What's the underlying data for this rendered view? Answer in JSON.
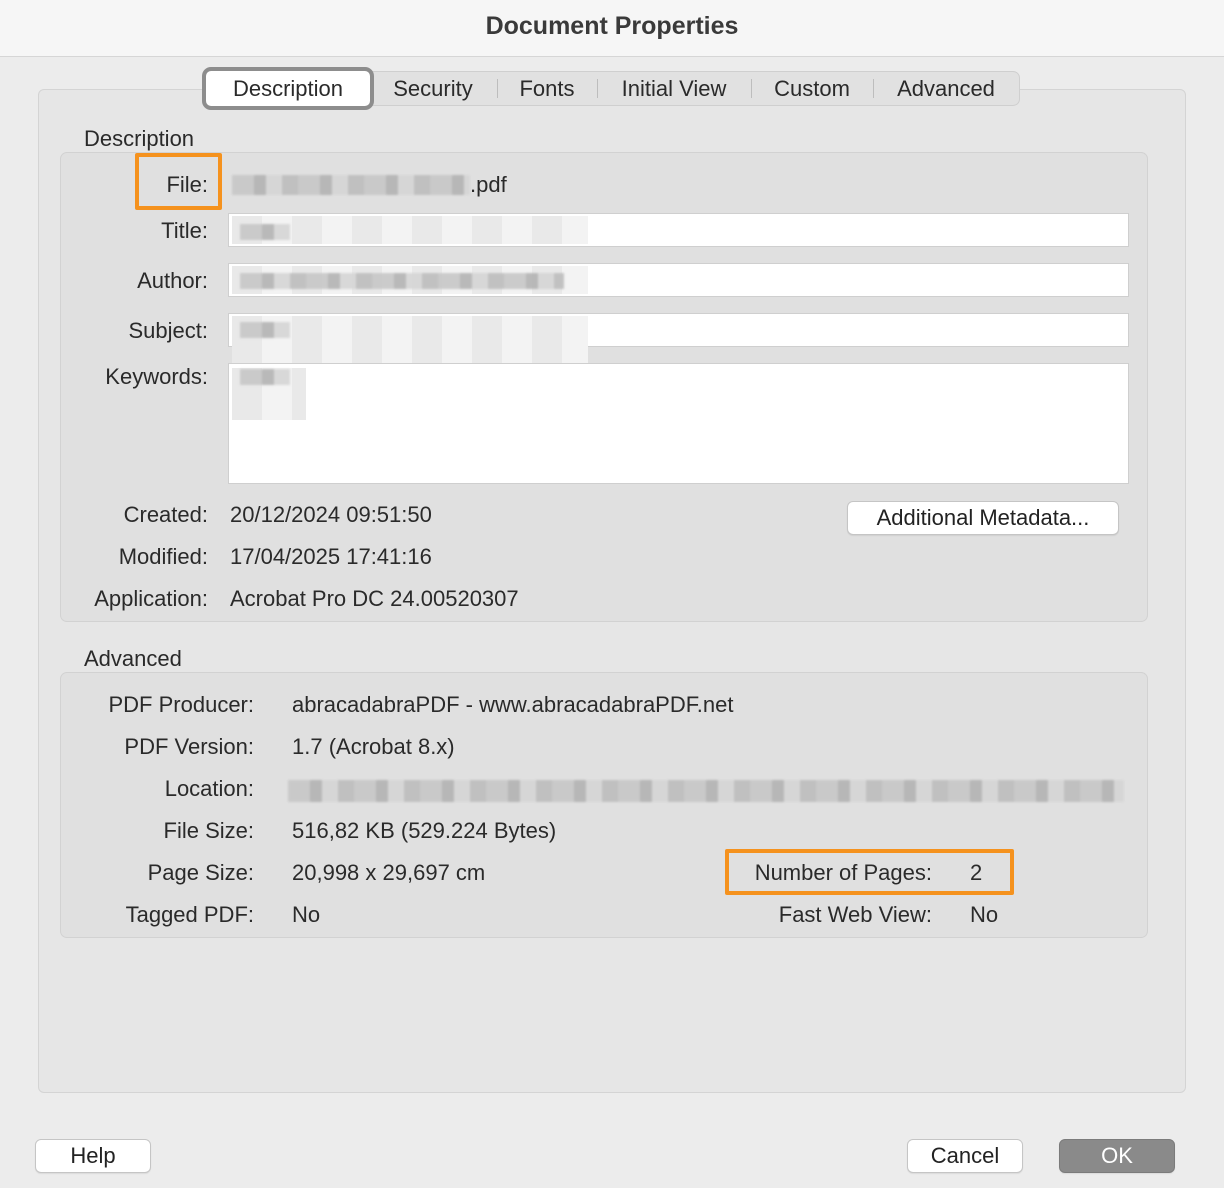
{
  "window": {
    "title": "Document Properties"
  },
  "tabs": [
    {
      "label": "Description",
      "active": true
    },
    {
      "label": "Security"
    },
    {
      "label": "Fonts"
    },
    {
      "label": "Initial View"
    },
    {
      "label": "Custom"
    },
    {
      "label": "Advanced"
    }
  ],
  "description": {
    "section_label": "Description",
    "file_label": "File:",
    "file_value": ".pdf",
    "title_label": "Title:",
    "author_label": "Author:",
    "subject_label": "Subject:",
    "keywords_label": "Keywords:",
    "created_label": "Created:",
    "created_value": "20/12/2024 09:51:50",
    "modified_label": "Modified:",
    "modified_value": "17/04/2025 17:41:16",
    "application_label": "Application:",
    "application_value": "Acrobat Pro DC 24.00520307",
    "metadata_button": "Additional Metadata..."
  },
  "advanced": {
    "section_label": "Advanced",
    "producer_label": "PDF Producer:",
    "producer_value": "abracadabraPDF - www.abracadabraPDF.net",
    "version_label": "PDF Version:",
    "version_value": "1.7 (Acrobat 8.x)",
    "location_label": "Location:",
    "filesize_label": "File Size:",
    "filesize_value": "516,82 KB (529.224 Bytes)",
    "pagesize_label": "Page Size:",
    "pagesize_value": "20,998 x 29,697 cm",
    "pages_label": "Number of Pages:",
    "pages_value": "2",
    "tagged_label": "Tagged PDF:",
    "tagged_value": "No",
    "fastweb_label": "Fast Web View:",
    "fastweb_value": "No"
  },
  "footer": {
    "help_label": "Help",
    "cancel_label": "Cancel",
    "ok_label": "OK"
  },
  "colors": {
    "highlight": "#f5921e",
    "ok_button": "#8a8a8a"
  }
}
